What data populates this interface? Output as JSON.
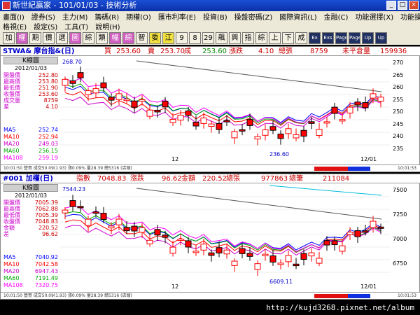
{
  "window": {
    "title": "新世紀贏家 - 101/01/03 - 技術分析",
    "buttons": [
      "_",
      "□",
      "×"
    ]
  },
  "menu1": [
    "畫面(I)",
    "證券(S)",
    "主力(M)",
    "籌碼(R)",
    "期權(O)",
    "匯市利率(E)",
    "投資(B)",
    "操盤密碼(Z)",
    "國際資訊(L)",
    "金融(C)",
    "功能選擇(X)",
    "功能操作(T)"
  ],
  "menu2": [
    "格視(E)",
    "設定(S)",
    "工具(T)",
    "說明(H)"
  ],
  "toolbar": [
    "加",
    "權",
    "期",
    "價",
    "選",
    "圖",
    "綜",
    "類",
    "幅",
    "綜",
    "智",
    "委",
    "江",
    "9",
    "8",
    "29",
    "飆",
    "興",
    "指",
    "綜",
    "上",
    "下",
    "成",
    "Ex",
    "Exs",
    "Page",
    "Page",
    "Up",
    "Up"
  ],
  "panel1": {
    "symbol": "STWA& 摩台指&(日)",
    "buy_label": "買",
    "buy": "253.60",
    "sell_label": "賣",
    "sell": "253.70",
    "deal_label": "成",
    "deal": "253.60",
    "change_label": "漲跌",
    "change": "4.10",
    "volume_label": "總張",
    "volume": "8759",
    "oi_label": "未平倉量",
    "oi": "159936",
    "kline_label": "K線圖",
    "date": "2012/01/03",
    "stats": [
      {
        "label": "開盤價",
        "value": "252.80"
      },
      {
        "label": "最高價",
        "value": "253.80"
      },
      {
        "label": "最低價",
        "value": "251.90"
      },
      {
        "label": "收盤價",
        "value": "253.60"
      },
      {
        "label": "成交量",
        "value": "8759"
      },
      {
        "label": "差",
        "value": "4.10"
      }
    ],
    "ma": [
      {
        "label": "MA5",
        "value": "252.74",
        "color": "#0000ff"
      },
      {
        "label": "MA10",
        "value": "252.94",
        "color": "#ff0000"
      },
      {
        "label": "MA20",
        "value": "249.03",
        "color": "#cc00cc"
      },
      {
        "label": "MA60",
        "value": "256.15",
        "color": "#00aa00"
      },
      {
        "label": "MA108",
        "value": "259.19",
        "color": "#ff00ff"
      }
    ],
    "high_mark": "268.70",
    "low_mark": "236.60",
    "y_ticks": [
      "270",
      "265",
      "260",
      "255",
      "250",
      "245",
      "240",
      "235"
    ],
    "x_labels": [
      "12",
      "12/01"
    ],
    "status": "10:01:50 營買 成交50.09(1.93) 漲0.09% 量28.39 總5316 (店頭)",
    "time": "10:01:53"
  },
  "panel2": {
    "symbol": "#001 加權(日)",
    "index_label": "指數",
    "index": "7048.83",
    "change_label": "漲跌",
    "change": "96.62",
    "amount_label": "金額",
    "amount": "220.52",
    "volume_label": "總張",
    "volume": "977863",
    "count_label": "總筆",
    "count": "211084",
    "kline_label": "K線圖",
    "date": "2012/01/03",
    "stats": [
      {
        "label": "開盤價",
        "value": "7005.39"
      },
      {
        "label": "最高價",
        "value": "7062.88"
      },
      {
        "label": "最低價",
        "value": "7005.39"
      },
      {
        "label": "收盤價",
        "value": "7048.83"
      },
      {
        "label": "金額",
        "value": "220.52"
      },
      {
        "label": "差",
        "value": "96.62"
      }
    ],
    "ma": [
      {
        "label": "MA5",
        "value": "7040.92",
        "color": "#0000ff"
      },
      {
        "label": "MA10",
        "value": "7042.58",
        "color": "#ff0000"
      },
      {
        "label": "MA20",
        "value": "6947.43",
        "color": "#cc00cc"
      },
      {
        "label": "MA60",
        "value": "7191.49",
        "color": "#00aa00"
      },
      {
        "label": "MA108",
        "value": "7320.75",
        "color": "#ff00ff"
      }
    ],
    "high_mark": "7544.23",
    "low_mark": "6609.11",
    "y_ticks": [
      "7500",
      "7250",
      "7000",
      "6750"
    ],
    "x_labels": [
      "12",
      "12/01"
    ],
    "status": "10:01:50 營買 成交50.09(1.93) 漲0.09% 量28.39 總5316 (店頭)",
    "time": "10:01:53"
  },
  "watermark": "http://kujd3268.pixnet.net/album",
  "colors": {
    "up": "#ff0000",
    "down": "#000000",
    "up_fill": "#ffffff"
  }
}
